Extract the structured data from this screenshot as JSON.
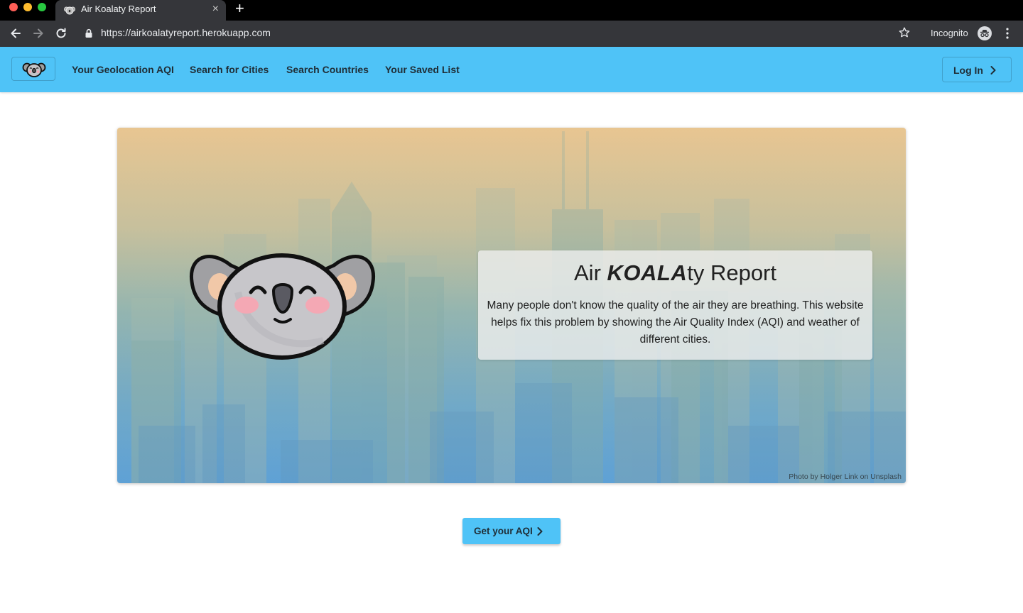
{
  "browser": {
    "tab_title": "Air Koalaty Report",
    "tab_close": "×",
    "new_tab": "+",
    "url": "https://airkoalatyreport.herokuapp.com",
    "incognito_label": "Incognito"
  },
  "navbar": {
    "brand_icon": "koala-logo-icon",
    "links": [
      "Your Geolocation AQI",
      "Search for Cities",
      "Search Countries",
      "Your Saved List"
    ],
    "login_label": "Log In"
  },
  "hero": {
    "title_prefix": "Air ",
    "title_accent": "KOALA",
    "title_suffix": "ty Report",
    "description": "Many people don't know the quality of the air they are breathing. This website helps fix this problem by showing the Air Quality Index (AQI) and weather of different cities.",
    "photo_credit": "Photo by Holger Link on Unsplash"
  },
  "cta": {
    "label": "Get your AQI"
  },
  "colors": {
    "nav_background": "#4fc3f7",
    "hero_sky_top": "#ecc690",
    "hero_sky_bottom": "#5a9fd6"
  }
}
